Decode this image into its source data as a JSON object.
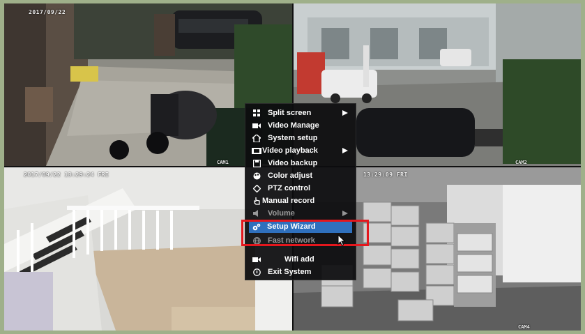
{
  "cameras": [
    {
      "id": "cam1",
      "timestamp": "2017/09/22",
      "label": "CAM1"
    },
    {
      "id": "cam2",
      "timestamp": "",
      "label": "CAM2"
    },
    {
      "id": "cam3",
      "timestamp": "2017/09/22 13:29:24 FRI",
      "label": ""
    },
    {
      "id": "cam4",
      "timestamp": "13:29:09 FRI",
      "label": "CAM4"
    }
  ],
  "menu": {
    "items": [
      {
        "label": "Split screen",
        "icon": "split-screen-icon",
        "submenu": true
      },
      {
        "label": "Video Manage",
        "icon": "video-camera-icon",
        "submenu": false
      },
      {
        "label": "System setup",
        "icon": "home-icon",
        "submenu": false
      },
      {
        "label": "Video playback",
        "icon": "film-playback-icon",
        "submenu": true
      },
      {
        "label": "Video backup",
        "icon": "floppy-disk-icon",
        "submenu": false
      },
      {
        "label": "Color adjust",
        "icon": "palette-icon",
        "submenu": false
      },
      {
        "label": "PTZ control",
        "icon": "diamond-icon",
        "submenu": false
      },
      {
        "label": "Manual record",
        "icon": "hand-pointer-icon",
        "submenu": false
      },
      {
        "label": "Volume",
        "icon": "speaker-icon",
        "submenu": true
      },
      {
        "label": "Setup Wizard",
        "icon": "gears-icon",
        "submenu": false,
        "selected": true
      },
      {
        "label": "Fast network",
        "icon": "globe-icon",
        "submenu": false
      },
      {
        "label": "Wifi add",
        "icon": "wifi-camera-icon",
        "submenu": false
      },
      {
        "label": "Exit System",
        "icon": "power-icon",
        "submenu": false
      }
    ]
  },
  "colors": {
    "highlight_box": "#e4171d",
    "selected_item": "#2f70bd",
    "menu_background": "#0c0c0e"
  }
}
